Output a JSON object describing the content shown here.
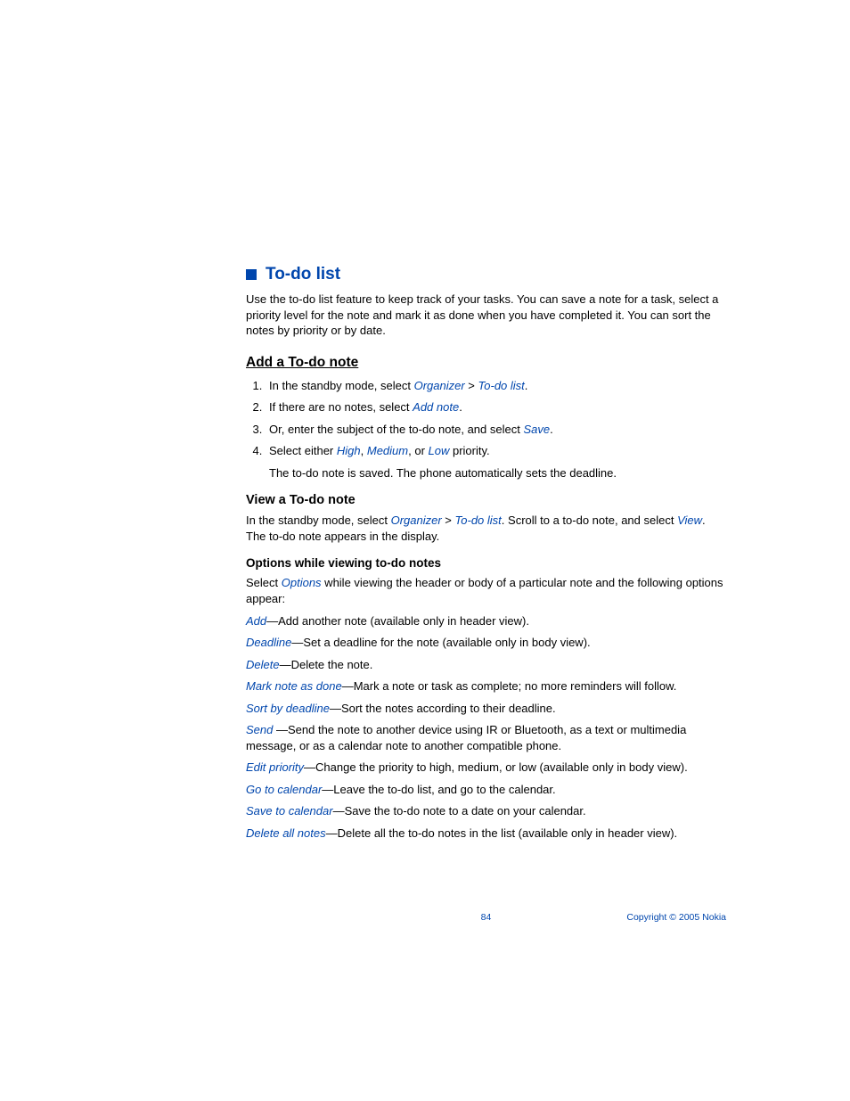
{
  "section": {
    "title": "To-do list",
    "intro": "Use the to-do list feature to keep track of your tasks. You can save a note for a task, select a priority level for the note and mark it as done when you have completed it. You can sort the notes by priority or by date."
  },
  "add": {
    "heading": "Add a To-do note",
    "steps": {
      "s1a": "In the standby mode, select ",
      "s1b": "Organizer",
      "s1c": " > ",
      "s1d": "To-do list",
      "s1e": ".",
      "s2a": "If there are no notes, select ",
      "s2b": "Add note",
      "s2c": ".",
      "s3a": "Or, enter the subject of the to-do note, and select ",
      "s3b": "Save",
      "s3c": ".",
      "s4a": "Select either ",
      "s4b": "High",
      "s4c": ", ",
      "s4d": "Medium",
      "s4e": ", or ",
      "s4f": "Low",
      "s4g": " priority.",
      "s4note": "The to-do note is saved. The phone automatically sets the deadline."
    }
  },
  "view": {
    "heading": "View a To-do note",
    "p1a": "In the standby mode, select ",
    "p1b": "Organizer",
    "p1c": " > ",
    "p1d": "To-do list",
    "p1e": ". Scroll to a to-do note, and select ",
    "p1f": "View",
    "p1g": ". The to-do note appears in the display."
  },
  "options": {
    "heading": "Options while viewing to-do notes",
    "introA": "Select ",
    "introB": "Options",
    "introC": " while viewing the header or body of a particular note and the following options appear:",
    "items": {
      "add_l": "Add",
      "add_t": "—Add another note (available only in header view).",
      "deadline_l": "Deadline",
      "deadline_t": "—Set a deadline for the note (available only in body view).",
      "delete_l": "Delete",
      "delete_t": "—Delete the note.",
      "mark_l": "Mark note as done",
      "mark_t": "—Mark a note or task as complete; no more reminders will follow.",
      "sort_l": "Sort by deadline",
      "sort_t": "—Sort the notes according to their deadline.",
      "send_l": "Send ",
      "send_t": "—Send the note to another device using IR or Bluetooth, as a text or multimedia message, or as a calendar note to another compatible phone.",
      "edit_l": "Edit priority",
      "edit_t": "—Change the priority to high, medium, or low (available only in body view).",
      "cal_l": "Go to calendar",
      "cal_t": "—Leave the to-do list, and go to the calendar.",
      "save_l": "Save to calendar",
      "save_t": "—Save the to-do note to a date on your calendar.",
      "delall_l": "Delete all notes",
      "delall_t": "—Delete all the to-do notes in the list (available only in header view)."
    }
  },
  "footer": {
    "page": "84",
    "copyright": "Copyright © 2005 Nokia"
  }
}
